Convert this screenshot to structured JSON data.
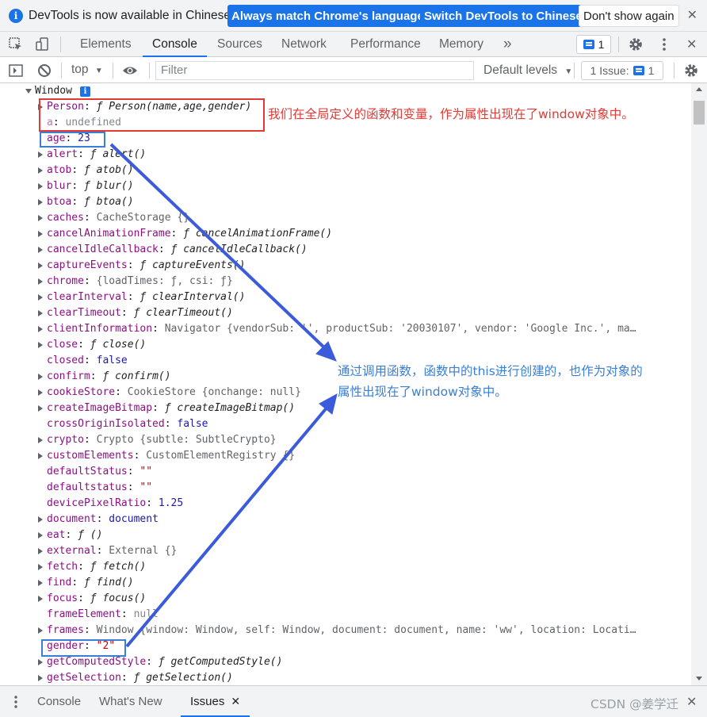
{
  "infobar": {
    "message": "DevTools is now available in Chinese!",
    "btn_match": "Always match Chrome's language",
    "btn_switch": "Switch DevTools to Chinese",
    "btn_dont_show": "Don't show again",
    "close": "✕"
  },
  "tabs": {
    "elements": "Elements",
    "console": "Console",
    "sources": "Sources",
    "network": "Network",
    "performance": "Performance",
    "memory": "Memory",
    "more": "»",
    "issues_count": "1",
    "close": "✕"
  },
  "console_toolbar": {
    "context": "top",
    "filter_placeholder": "Filter",
    "levels": "Default levels",
    "issues_label": "1 Issue:",
    "issues_count": "1"
  },
  "tree": {
    "root": "Window",
    "rows": [
      {
        "key": "Person",
        "sep": ": ",
        "f": "ƒ ",
        "v": "Person(name,age,gender)",
        "t": "fn",
        "exp": true,
        "dim": false
      },
      {
        "key": "a",
        "sep": ": ",
        "f": "",
        "v": "undefined",
        "t": "undef",
        "exp": false,
        "dim": true
      },
      {
        "key": "age",
        "sep": ": ",
        "f": "",
        "v": "23",
        "t": "num",
        "exp": false,
        "dim": false
      },
      {
        "key": "alert",
        "sep": ": ",
        "f": "ƒ ",
        "v": "alert()",
        "t": "fn",
        "exp": true,
        "dim": false
      },
      {
        "key": "atob",
        "sep": ": ",
        "f": "ƒ ",
        "v": "atob()",
        "t": "fn",
        "exp": true,
        "dim": false
      },
      {
        "key": "blur",
        "sep": ": ",
        "f": "ƒ ",
        "v": "blur()",
        "t": "fn",
        "exp": true,
        "dim": false
      },
      {
        "key": "btoa",
        "sep": ": ",
        "f": "ƒ ",
        "v": "btoa()",
        "t": "fn",
        "exp": true,
        "dim": false
      },
      {
        "key": "caches",
        "sep": ": ",
        "f": "",
        "v": "CacheStorage {}",
        "t": "obj",
        "exp": true,
        "dim": false
      },
      {
        "key": "cancelAnimationFrame",
        "sep": ": ",
        "f": "ƒ ",
        "v": "cancelAnimationFrame()",
        "t": "fn",
        "exp": true,
        "dim": false
      },
      {
        "key": "cancelIdleCallback",
        "sep": ": ",
        "f": "ƒ ",
        "v": "cancelIdleCallback()",
        "t": "fn",
        "exp": true,
        "dim": false
      },
      {
        "key": "captureEvents",
        "sep": ": ",
        "f": "ƒ ",
        "v": "captureEvents()",
        "t": "fn",
        "exp": true,
        "dim": false
      },
      {
        "key": "chrome",
        "sep": ": ",
        "f": "",
        "v": "{loadTimes: ƒ, csi: ƒ}",
        "t": "obj",
        "exp": true,
        "dim": false
      },
      {
        "key": "clearInterval",
        "sep": ": ",
        "f": "ƒ ",
        "v": "clearInterval()",
        "t": "fn",
        "exp": true,
        "dim": false
      },
      {
        "key": "clearTimeout",
        "sep": ": ",
        "f": "ƒ ",
        "v": "clearTimeout()",
        "t": "fn",
        "exp": true,
        "dim": false
      },
      {
        "key": "clientInformation",
        "sep": ": ",
        "f": "",
        "v": "Navigator {vendorSub: '', productSub: '20030107', vendor: 'Google Inc.', ma…",
        "t": "obj",
        "exp": true,
        "dim": false
      },
      {
        "key": "close",
        "sep": ": ",
        "f": "ƒ ",
        "v": "close()",
        "t": "fn",
        "exp": true,
        "dim": false
      },
      {
        "key": "closed",
        "sep": ": ",
        "f": "",
        "v": "false",
        "t": "bool",
        "exp": false,
        "dim": false
      },
      {
        "key": "confirm",
        "sep": ": ",
        "f": "ƒ ",
        "v": "confirm()",
        "t": "fn",
        "exp": true,
        "dim": false
      },
      {
        "key": "cookieStore",
        "sep": ": ",
        "f": "",
        "v": "CookieStore {onchange: null}",
        "t": "obj",
        "exp": true,
        "dim": false
      },
      {
        "key": "createImageBitmap",
        "sep": ": ",
        "f": "ƒ ",
        "v": "createImageBitmap()",
        "t": "fn",
        "exp": true,
        "dim": false
      },
      {
        "key": "crossOriginIsolated",
        "sep": ": ",
        "f": "",
        "v": "false",
        "t": "bool",
        "exp": false,
        "dim": false
      },
      {
        "key": "crypto",
        "sep": ": ",
        "f": "",
        "v": "Crypto {subtle: SubtleCrypto}",
        "t": "obj",
        "exp": true,
        "dim": false
      },
      {
        "key": "customElements",
        "sep": ": ",
        "f": "",
        "v": "CustomElementRegistry {}",
        "t": "obj",
        "exp": true,
        "dim": false
      },
      {
        "key": "defaultStatus",
        "sep": ": ",
        "f": "",
        "v": "\"\"",
        "t": "str",
        "exp": false,
        "dim": false
      },
      {
        "key": "defaultstatus",
        "sep": ": ",
        "f": "",
        "v": "\"\"",
        "t": "str",
        "exp": false,
        "dim": false
      },
      {
        "key": "devicePixelRatio",
        "sep": ": ",
        "f": "",
        "v": "1.25",
        "t": "num",
        "exp": false,
        "dim": false
      },
      {
        "key": "document",
        "sep": ": ",
        "f": "",
        "v": "document",
        "t": "lnk",
        "exp": true,
        "dim": false
      },
      {
        "key": "eat",
        "sep": ": ",
        "f": "ƒ ",
        "v": "()",
        "t": "fn",
        "exp": true,
        "dim": false
      },
      {
        "key": "external",
        "sep": ": ",
        "f": "",
        "v": "External {}",
        "t": "obj",
        "exp": true,
        "dim": false
      },
      {
        "key": "fetch",
        "sep": ": ",
        "f": "ƒ ",
        "v": "fetch()",
        "t": "fn",
        "exp": true,
        "dim": false
      },
      {
        "key": "find",
        "sep": ": ",
        "f": "ƒ ",
        "v": "find()",
        "t": "fn",
        "exp": true,
        "dim": false
      },
      {
        "key": "focus",
        "sep": ": ",
        "f": "ƒ ",
        "v": "focus()",
        "t": "fn",
        "exp": true,
        "dim": false
      },
      {
        "key": "frameElement",
        "sep": ": ",
        "f": "",
        "v": "null",
        "t": "undef",
        "exp": false,
        "dim": false
      },
      {
        "key": "frames",
        "sep": ": ",
        "f": "",
        "v": "Window {window: Window, self: Window, document: document, name: 'ww', location: Locati…",
        "t": "obj",
        "exp": true,
        "dim": false
      },
      {
        "key": "gender",
        "sep": ": ",
        "f": "",
        "v": "\"2\"",
        "t": "str",
        "exp": false,
        "dim": false
      },
      {
        "key": "getComputedStyle",
        "sep": ": ",
        "f": "ƒ ",
        "v": "getComputedStyle()",
        "t": "fn",
        "exp": true,
        "dim": false
      },
      {
        "key": "getSelection",
        "sep": ": ",
        "f": "ƒ ",
        "v": "getSelection()",
        "t": "fn",
        "exp": true,
        "dim": false
      }
    ]
  },
  "annotations": {
    "note_red": "我们在全局定义的函数和变量，作为属性出现在了window对象中。",
    "note_blue_1": "通过调用函数，函数中的this进行创建的，也作为对象的",
    "note_blue_2": "属性出现在了window对象中。",
    "red_color": "#e53935",
    "blue_color": "#3a7fd5",
    "arrow_color": "#3b5bdb"
  },
  "drawer": {
    "console": "Console",
    "whats_new": "What's New",
    "issues": "Issues",
    "issues_close": "✕",
    "close": "✕"
  },
  "watermark": "CSDN @姜学迁"
}
